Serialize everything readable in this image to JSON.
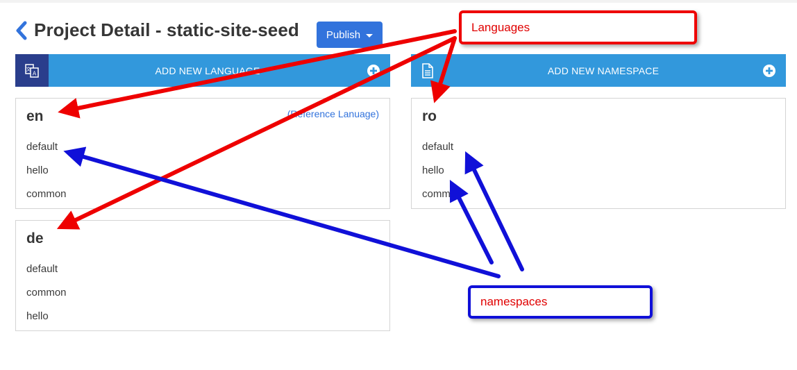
{
  "header": {
    "title": "Project Detail - static-site-seed",
    "publish_label": "Publish"
  },
  "languages_bar": {
    "label": "ADD NEW LANGUAGE"
  },
  "namespace_bar": {
    "label": "ADD NEW NAMESPACE"
  },
  "languages": [
    {
      "code": "en",
      "reference_note": "(Reference Lanuage)",
      "namespaces": [
        "default",
        "hello",
        "common"
      ]
    },
    {
      "code": "de",
      "namespaces": [
        "default",
        "common",
        "hello"
      ]
    }
  ],
  "namespace_card": {
    "code": "ro",
    "namespaces": [
      "default",
      "hello",
      "common"
    ]
  },
  "annotations": {
    "languages_label": "Languages",
    "namespaces_label": "namespaces",
    "red": "#ee0000",
    "blue": "#1010d8"
  }
}
